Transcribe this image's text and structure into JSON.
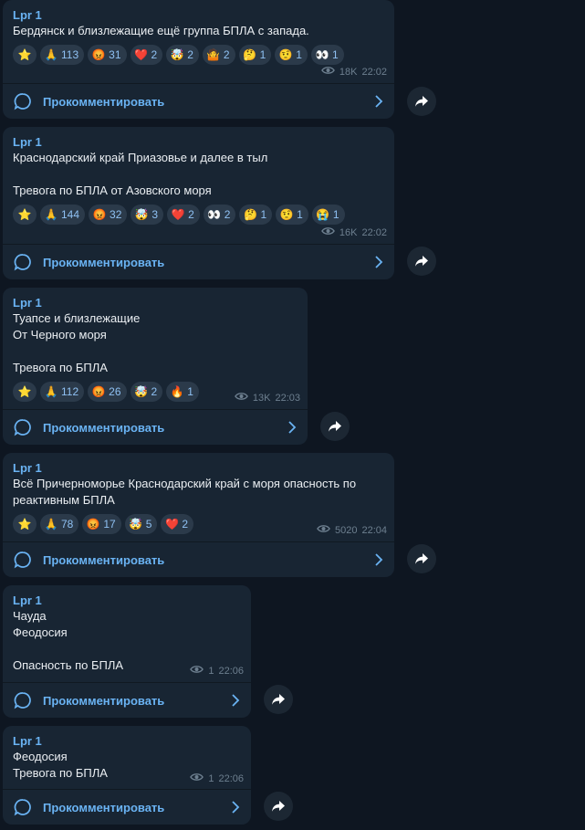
{
  "colors": {
    "background": "#0e1621",
    "bubble": "#182533",
    "accent": "#6ab3f3",
    "reaction_bg": "#2b3a4a",
    "meta": "#6d7f8f"
  },
  "comment_label": "Прокомментировать",
  "icons": {
    "views": "eye-icon",
    "comment": "comment-bubble-icon",
    "chevron": "chevron-right-icon",
    "share": "share-arrow-icon"
  },
  "messages": [
    {
      "author": "Lpr 1",
      "text": "Бердянск и близлежащие ещё группа БПЛА с запада.",
      "reactions": [
        {
          "emoji": "⭐",
          "count": ""
        },
        {
          "emoji": "🙏",
          "count": "113"
        },
        {
          "emoji": "😡",
          "count": "31"
        },
        {
          "emoji": "❤️",
          "count": "2"
        },
        {
          "emoji": "🤯",
          "count": "2"
        },
        {
          "emoji": "🤷",
          "count": "2"
        },
        {
          "emoji": "🤔",
          "count": "1"
        },
        {
          "emoji": "🤨",
          "count": "1"
        },
        {
          "emoji": "👀",
          "count": "1"
        }
      ],
      "views": "18K",
      "time": "22:02"
    },
    {
      "author": "Lpr 1",
      "text": "Краснодарский край Приазовье и далее в тыл\n\nТревога по БПЛА от Азовского моря",
      "reactions": [
        {
          "emoji": "⭐",
          "count": ""
        },
        {
          "emoji": "🙏",
          "count": "144"
        },
        {
          "emoji": "😡",
          "count": "32"
        },
        {
          "emoji": "🤯",
          "count": "3"
        },
        {
          "emoji": "❤️",
          "count": "2"
        },
        {
          "emoji": "👀",
          "count": "2"
        },
        {
          "emoji": "🤔",
          "count": "1"
        },
        {
          "emoji": "🤨",
          "count": "1"
        },
        {
          "emoji": "😭",
          "count": "1"
        }
      ],
      "views": "16K",
      "time": "22:02"
    },
    {
      "author": "Lpr 1",
      "text": "Туапсе и близлежащие\nОт Черного моря\n\nТревога по БПЛА",
      "reactions": [
        {
          "emoji": "⭐",
          "count": ""
        },
        {
          "emoji": "🙏",
          "count": "112"
        },
        {
          "emoji": "😡",
          "count": "26"
        },
        {
          "emoji": "🤯",
          "count": "2"
        },
        {
          "emoji": "🔥",
          "count": "1"
        }
      ],
      "views": "13K",
      "time": "22:03"
    },
    {
      "author": "Lpr 1",
      "text": "Всё Причерноморье Краснодарский край с моря опасность по реактивным БПЛА",
      "reactions": [
        {
          "emoji": "⭐",
          "count": ""
        },
        {
          "emoji": "🙏",
          "count": "78"
        },
        {
          "emoji": "😡",
          "count": "17"
        },
        {
          "emoji": "🤯",
          "count": "5"
        },
        {
          "emoji": "❤️",
          "count": "2"
        }
      ],
      "views": "5020",
      "time": "22:04"
    },
    {
      "author": "Lpr 1",
      "text": "Чауда\nФеодосия\n\nОпасность по БПЛА",
      "reactions": [],
      "views": "1",
      "time": "22:06"
    },
    {
      "author": "Lpr 1",
      "text": "Феодосия\nТревога по БПЛА",
      "reactions": [],
      "views": "1",
      "time": "22:06"
    }
  ]
}
